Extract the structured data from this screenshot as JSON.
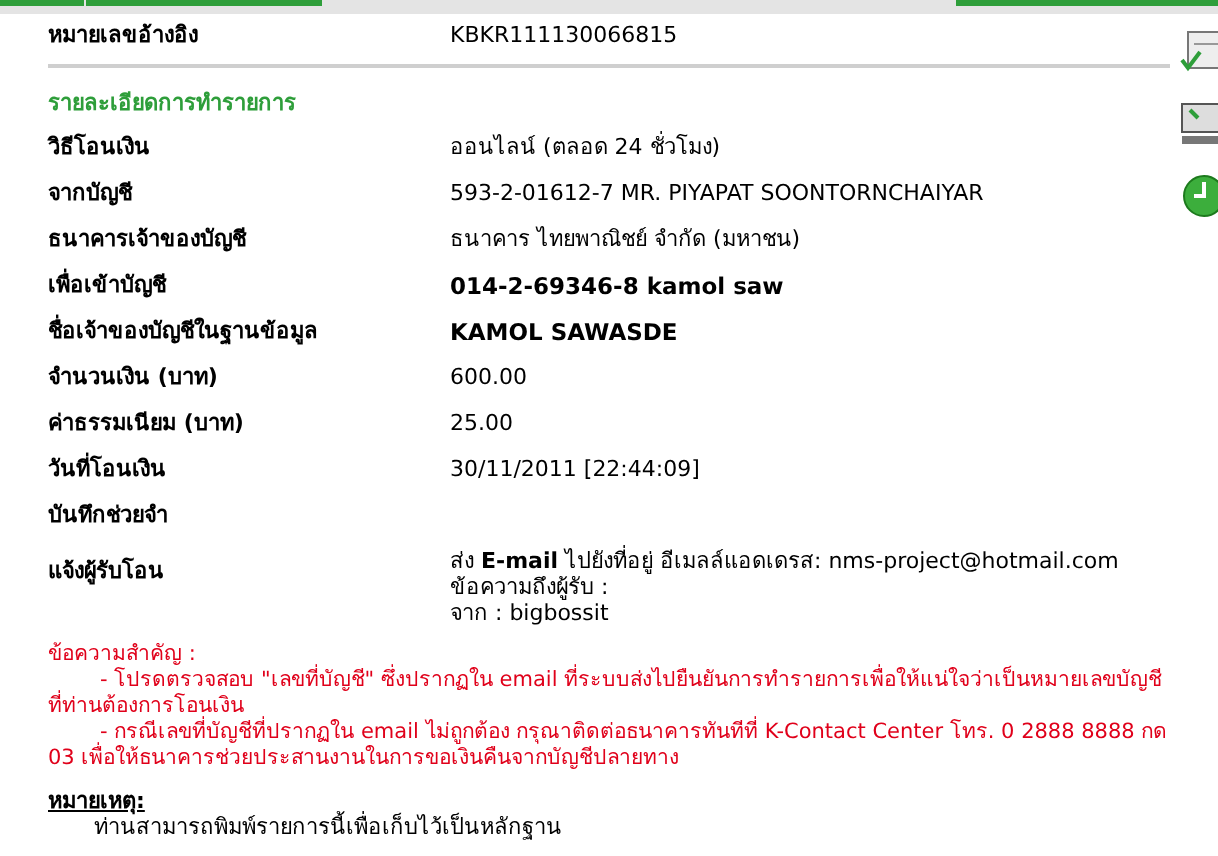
{
  "reference": {
    "label": "หมายเลขอ้างอิง",
    "value": "KBKR111130066815"
  },
  "section_title": "รายละเอียดการทำรายการ",
  "rows": [
    {
      "label": "วิธีโอนเงิน",
      "value": "ออนไลน์ (ตลอด 24 ชั่วโมง)",
      "bold": false
    },
    {
      "label": "จากบัญชี",
      "value": "593-2-01612-7 MR. PIYAPAT SOONTORNCHAIYAR",
      "bold": false
    },
    {
      "label": "ธนาคารเจ้าของบัญชี",
      "value": "ธนาคาร ไทยพาณิชย์ จำกัด (มหาชน)",
      "bold": false
    },
    {
      "label": "เพื่อเข้าบัญชี",
      "value": "014-2-69346-8 kamol saw",
      "bold": true
    },
    {
      "label": "ชื่อเจ้าของบัญชีในฐานข้อมูล",
      "value": "KAMOL SAWASDE",
      "bold": true
    },
    {
      "label": "จำนวนเงิน (บาท)",
      "value": "600.00",
      "bold": false
    },
    {
      "label": "ค่าธรรมเนียม (บาท)",
      "value": "25.00",
      "bold": false
    },
    {
      "label": "วันที่โอนเงิน",
      "value": "30/11/2011 [22:44:09]",
      "bold": false
    },
    {
      "label": "บันทึกช่วยจำ"
    }
  ],
  "notify": {
    "label": "แจ้งผู้รับโอน",
    "lines": [
      "ส่ง **E-mail** ไปยังที่อยู่ อีเมลล์แอดเดรส: nms-project@hotmail.com",
      "ข้อความถึงผู้รับ :",
      "จาก : bigbossit"
    ]
  },
  "important": {
    "title": "ข้อความสำคัญ :",
    "items": [
      "- โปรดตรวจสอบ \"เลขที่บัญชี\" ซึ่งปรากฏใน email ที่ระบบส่งไปยืนยันการทำรายการเพื่อให้แน่ใจว่าเป็นหมายเลขบัญชีที่ท่านต้องการโอนเงิน",
      "- กรณีเลขที่บัญชีที่ปรากฏใน email ไม่ถูกต้อง กรุณาติดต่อธนาคารทันทีที่ K-Contact Center โทร. 0 2888 8888 กด 03 เพื่อให้ธนาคารช่วยประสานงานในการขอเงินคืนจากบัญชีปลายทาง"
    ]
  },
  "note": {
    "title": "หมายเหตุ:",
    "text": "ท่านสามารถพิมพ์รายการนี้เพื่อเก็บไว้เป็นหลักฐาน"
  }
}
